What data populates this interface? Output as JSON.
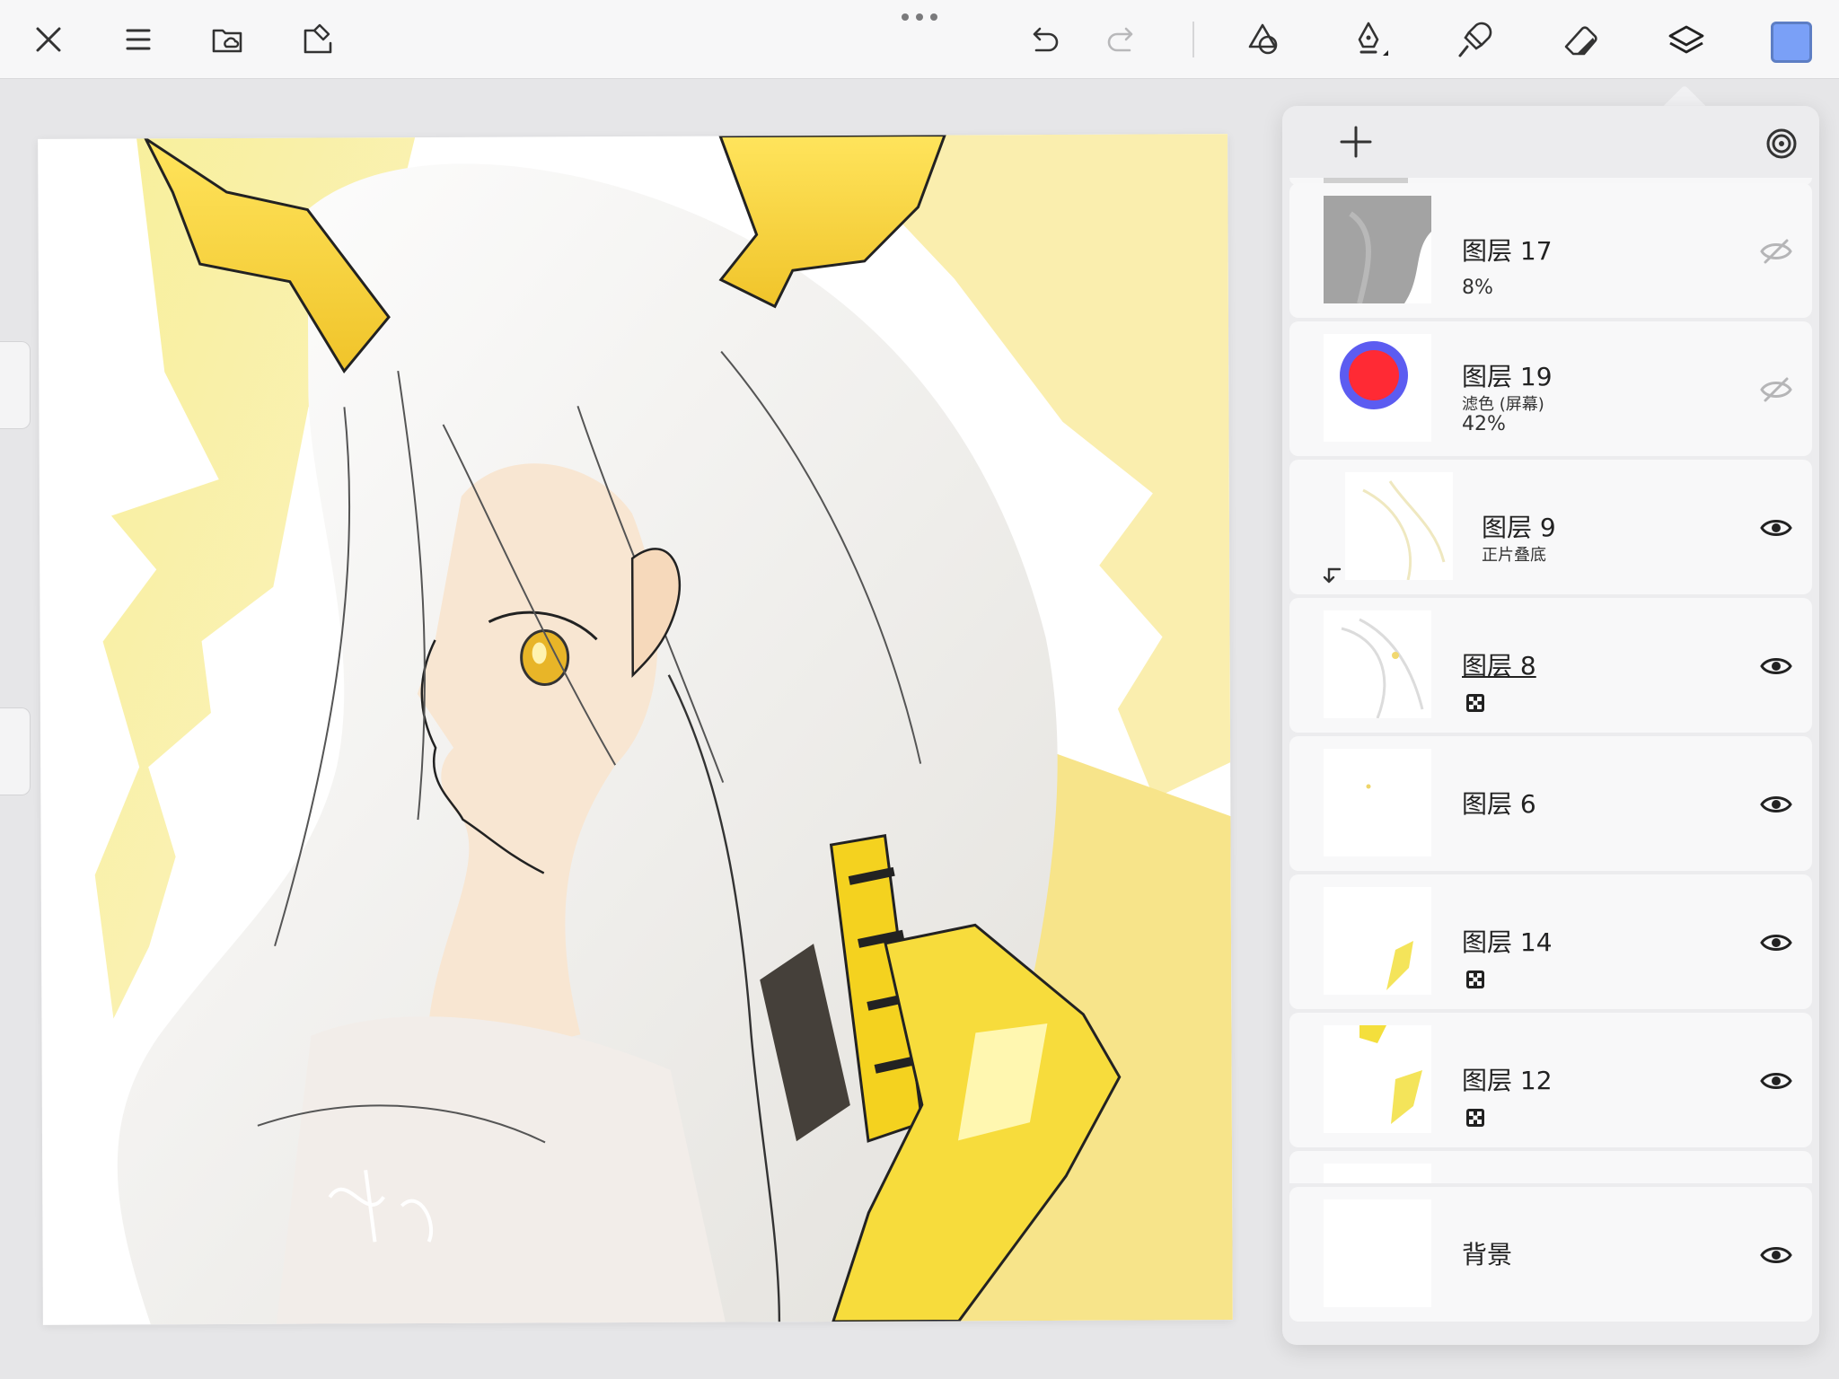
{
  "toolbar": {
    "buttons": [
      {
        "name": "close-icon"
      },
      {
        "name": "menu-icon"
      },
      {
        "name": "folder-cloud-icon"
      },
      {
        "name": "import-icon"
      },
      {
        "name": "undo-icon"
      },
      {
        "name": "redo-icon"
      },
      {
        "name": "shapes-icon"
      },
      {
        "name": "pen-tool-icon"
      },
      {
        "name": "fill-bucket-icon"
      },
      {
        "name": "eraser-icon"
      },
      {
        "name": "layers-icon"
      }
    ],
    "current_color": "#7aa0f7"
  },
  "layers_panel": {
    "layers": [
      {
        "name": "图层 17",
        "blend": "",
        "opacity": "8%",
        "visible": false
      },
      {
        "name": "图层 19",
        "blend": "滤色 (屏幕)",
        "opacity": "42%",
        "visible": false
      },
      {
        "name": "图层 9",
        "blend": "正片叠底",
        "opacity": "",
        "visible": true,
        "clipped": true
      },
      {
        "name": "图层 8",
        "blend": "",
        "opacity": "",
        "visible": true,
        "locked": true,
        "selected": true
      },
      {
        "name": "图层 6",
        "blend": "",
        "opacity": "",
        "visible": true
      },
      {
        "name": "图层 14",
        "blend": "",
        "opacity": "",
        "visible": true,
        "locked": true
      },
      {
        "name": "图层 12",
        "blend": "",
        "opacity": "",
        "visible": true,
        "locked": true
      },
      {
        "name": "背景",
        "blend": "",
        "opacity": "",
        "visible": true
      }
    ]
  },
  "colors": {
    "accent_blue": "#7aa0f7",
    "hair_yellow": "#f5d23a",
    "panel_bg": "#ececee"
  }
}
